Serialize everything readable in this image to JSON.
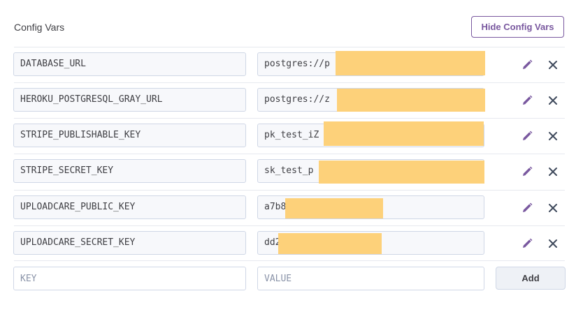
{
  "header": {
    "title": "Config Vars",
    "hide_button_label": "Hide Config Vars"
  },
  "vars": [
    {
      "key": "DATABASE_URL",
      "value": "postgres://p"
    },
    {
      "key": "HEROKU_POSTGRESQL_GRAY_URL",
      "value": "postgres://z"
    },
    {
      "key": "STRIPE_PUBLISHABLE_KEY",
      "value": "pk_test_iZ"
    },
    {
      "key": "STRIPE_SECRET_KEY",
      "value": "sk_test_p"
    },
    {
      "key": "UPLOADCARE_PUBLIC_KEY",
      "value": "a7b8"
    },
    {
      "key": "UPLOADCARE_SECRET_KEY",
      "value": "dd2"
    }
  ],
  "new_var": {
    "key_placeholder": "KEY",
    "value_placeholder": "VALUE",
    "add_label": "Add"
  },
  "colors": {
    "accent": "#79589f",
    "redaction": "#fdd17a"
  },
  "icons": {
    "edit": "pencil-icon",
    "delete": "close-icon"
  }
}
